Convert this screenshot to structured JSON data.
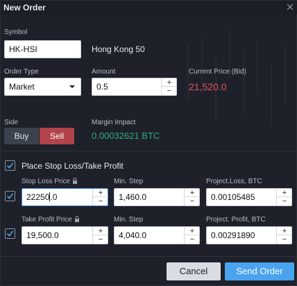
{
  "window": {
    "title": "New Order"
  },
  "symbol": {
    "label": "Symbol",
    "value": "HK-HSI",
    "name": "Hong Kong 50"
  },
  "order_type": {
    "label": "Order Type",
    "selected": "Market"
  },
  "amount": {
    "label": "Amount",
    "value": "0.5"
  },
  "current_price": {
    "label": "Current Price (Bid)",
    "value": "21,520.0",
    "color": "#e0525a"
  },
  "side": {
    "label": "Side",
    "buy_label": "Buy",
    "sell_label": "Sell",
    "selected": "Sell"
  },
  "margin": {
    "label": "Margin Impact",
    "value": "0.00032621 BTC",
    "color": "#2fae7c"
  },
  "sltp": {
    "checked": true,
    "label": "Place Stop Loss/Take Profit"
  },
  "stop_loss": {
    "checked": true,
    "price_label": "Stop Loss Price",
    "price_value_before_cursor": "22250",
    "price_value_after_cursor": ".0",
    "min_step_label": "Min. Step",
    "min_step_value": "1,460.0",
    "project_label": "Project.Loss, BTC",
    "project_value": "0.00105485"
  },
  "take_profit": {
    "checked": true,
    "price_label": "Take Profit Price",
    "price_value": "19,500.0",
    "min_step_label": "Min. Step",
    "min_step_value": "4,040.0",
    "project_label": "Project. Profit, BTC",
    "project_value": "0.00291890"
  },
  "footer": {
    "cancel_label": "Cancel",
    "send_label": "Send Order"
  },
  "icons": {
    "close": "close-icon",
    "lock": "lock-icon",
    "check": "check-icon",
    "caret": "chevron-down-icon"
  },
  "stepper_symbols": {
    "plus": "+",
    "minus": "−"
  }
}
